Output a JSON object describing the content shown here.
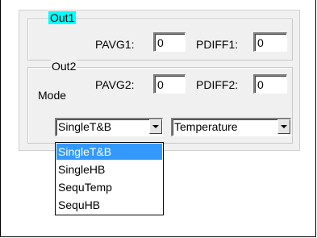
{
  "out1": {
    "legend": "Out1",
    "pavg1_label": "PAVG1:",
    "pavg1_value": "0",
    "pdiff1_label": "PDIFF1:",
    "pdiff1_value": "0"
  },
  "out2": {
    "legend": "Out2",
    "mode_label": "Mode",
    "pavg2_label": "PAVG2:",
    "pavg2_value": "0",
    "pdiff2_label": "PDIFF2:",
    "pdiff2_value": "0"
  },
  "mode_select": {
    "selected": "SingleT&B",
    "options": [
      "SingleT&B",
      "SingleHB",
      "SequTemp",
      "SequHB"
    ]
  },
  "sensor_select": {
    "selected": "Temperature"
  },
  "colors": {
    "legend_highlight": "#00ffff",
    "selection": "#3399ff"
  }
}
